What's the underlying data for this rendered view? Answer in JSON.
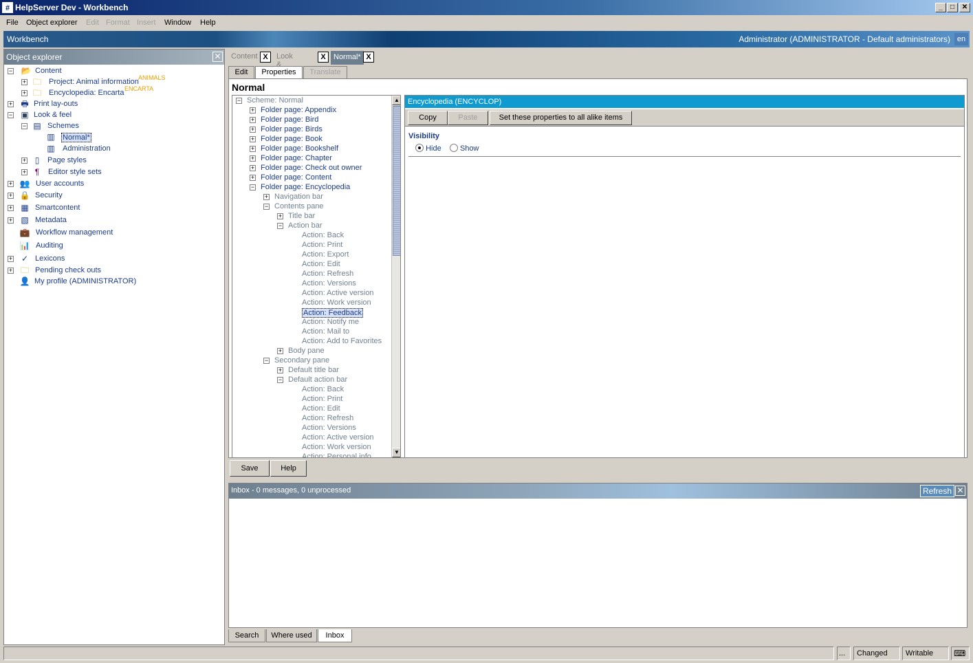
{
  "window": {
    "title": "HelpServer Dev - Workbench",
    "app_icon": "#"
  },
  "menubar": [
    {
      "label": "File",
      "enabled": true
    },
    {
      "label": "Object explorer",
      "enabled": true
    },
    {
      "label": "Edit",
      "enabled": false
    },
    {
      "label": "Format",
      "enabled": false
    },
    {
      "label": "Insert",
      "enabled": false
    },
    {
      "label": "Window",
      "enabled": true
    },
    {
      "label": "Help",
      "enabled": true
    }
  ],
  "banner": {
    "title": "Workbench",
    "user": "Administrator (ADMINISTRATOR - Default administrators)",
    "lang": "en"
  },
  "object_explorer": {
    "title": "Object explorer",
    "items": [
      {
        "label": "Content",
        "icon": "folder-open-icon"
      },
      {
        "label": "Project: Animal information",
        "icon": "project-folder-icon",
        "tag": "ANIMALS"
      },
      {
        "label": "Encyclopedia: Encarta",
        "icon": "folder-icon",
        "tag": "ENCARTA"
      },
      {
        "label": "Print lay-outs",
        "icon": "printer-icon"
      },
      {
        "label": "Look & feel",
        "icon": "monitor-icon"
      },
      {
        "label": "Schemes",
        "icon": "schemes-icon"
      },
      {
        "label": "Normal*",
        "icon": "scheme-icon"
      },
      {
        "label": "Administration",
        "icon": "scheme-icon"
      },
      {
        "label": "Page styles",
        "icon": "page-style-icon"
      },
      {
        "label": "Editor style sets",
        "icon": "style-set-icon"
      },
      {
        "label": "User accounts",
        "icon": "users-icon"
      },
      {
        "label": "Security",
        "icon": "lock-icon"
      },
      {
        "label": "Smartcontent",
        "icon": "smartcontent-icon"
      },
      {
        "label": "Metadata",
        "icon": "metadata-icon"
      },
      {
        "label": "Workflow management",
        "icon": "briefcase-icon"
      },
      {
        "label": "Auditing",
        "icon": "chart-icon"
      },
      {
        "label": "Lexicons",
        "icon": "spellcheck-icon"
      },
      {
        "label": "Pending check outs",
        "icon": "checkout-icon"
      },
      {
        "label": "My profile (ADMINISTRATOR)",
        "icon": "user-icon"
      }
    ]
  },
  "doc_tabs": [
    {
      "label": "Content",
      "close": "X"
    },
    {
      "label": "Look & feel",
      "close": "X"
    },
    {
      "label": "Normal*",
      "close": "X"
    }
  ],
  "sub_tabs": [
    {
      "label": "Edit"
    },
    {
      "label": "Properties"
    },
    {
      "label": "Translate"
    }
  ],
  "editor": {
    "title": "Normal",
    "tree": [
      "Scheme: Normal",
      "Folder page: Appendix",
      "Folder page: Bird",
      "Folder page: Birds",
      "Folder page: Book",
      "Folder page: Bookshelf",
      "Folder page: Chapter",
      "Folder page: Check out owner",
      "Folder page: Content",
      "Folder page: Encyclopedia",
      "Navigation bar",
      "Contents pane",
      "Title bar",
      "Action bar",
      "Action: Back",
      "Action: Print",
      "Action: Export",
      "Action: Edit",
      "Action: Refresh",
      "Action: Versions",
      "Action: Active version",
      "Action: Work version",
      "Action: Feedback",
      "Action: Notify me",
      "Action: Mail to",
      "Action: Add to Favorites",
      "Body pane",
      "Secondary pane",
      "Default title bar",
      "Default action bar",
      "Action: Back",
      "Action: Print",
      "Action: Edit",
      "Action: Refresh",
      "Action: Versions",
      "Action: Active version",
      "Action: Work version",
      "Action: Personal info"
    ],
    "props": {
      "header": "Encyclopedia (ENCYCLOP)",
      "copy": "Copy",
      "paste": "Paste",
      "set_all": "Set these properties to all alike items",
      "visibility_label": "Visibility",
      "hide": "Hide",
      "show": "Show",
      "selected": "Hide"
    }
  },
  "buttons": {
    "save": "Save",
    "help": "Help"
  },
  "inbox": {
    "title": "Inbox - 0 messages, 0 unprocessed",
    "refresh": "Refresh"
  },
  "bottom_tabs": [
    "Search",
    "Where used",
    "Inbox"
  ],
  "status": {
    "dots": "...",
    "changed": "Changed",
    "writable": "Writable"
  }
}
